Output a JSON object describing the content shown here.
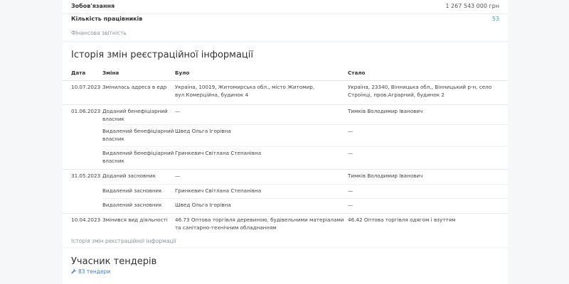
{
  "summary": {
    "obligations_label": "Зобов'язання",
    "obligations_value": "1 267 543 000 грн",
    "employees_label": "Кількість працівників",
    "employees_value": "53",
    "financial_link": "Фінансова звітність"
  },
  "history": {
    "title": "Історія змін реєстраційної інформації",
    "columns": [
      "Дата",
      "Зміна",
      "Було",
      "Стало"
    ],
    "rows": [
      {
        "date": "10.07.2023",
        "change": "Змінилась адреса в едр",
        "was": "Україна, 10019, Житомирська обл., місто Житомир, вул.Комерційна, будинок 4",
        "became": "Україна, 23340, Вінницька обл., Вінницький р-н, село Строїнці, пров.Аграрний, будинок 2"
      },
      {
        "date": "01.06.2023",
        "change": "Доданий бенефіціарний власник",
        "was": "—",
        "became": "Тимків Володимир Іванович"
      },
      {
        "date": "",
        "change": "Видалений бенефіціарний власник",
        "was": "Швед Ольга Ігорівна",
        "became": "—"
      },
      {
        "date": "",
        "change": "Видалений бенефіціарний власник",
        "was": "Гринкевич Світлана Степанівна",
        "became": "—"
      },
      {
        "date": "31.05.2023",
        "change": "Доданий засновник",
        "was": "—",
        "became": "Тимків Володимир Іванович"
      },
      {
        "date": "",
        "change": "Видалений засновник",
        "was": "Гринкевич Світлана Степанівна",
        "became": "—"
      },
      {
        "date": "",
        "change": "Видалений засновник",
        "was": "Швед Ольга Ігорівна",
        "became": "—"
      },
      {
        "date": "10.04.2023",
        "change": "Змінився вид діяльності",
        "was": "46.73 Оптова торгівля деревиною, будівельними матеріалами та санітарно-технічним обладнанням",
        "became": "46.42 Оптова торгівля одягом і взуттям"
      }
    ],
    "footer_link": "Історія змін реєстраційної інформації"
  },
  "tenders": {
    "title": "Учасник тендерів",
    "link": "83 тендери",
    "icon": "wrench-icon"
  },
  "colors": {
    "link": "#3f7fb5",
    "teal": "#3aa3a3",
    "muted": "#8a959c"
  }
}
